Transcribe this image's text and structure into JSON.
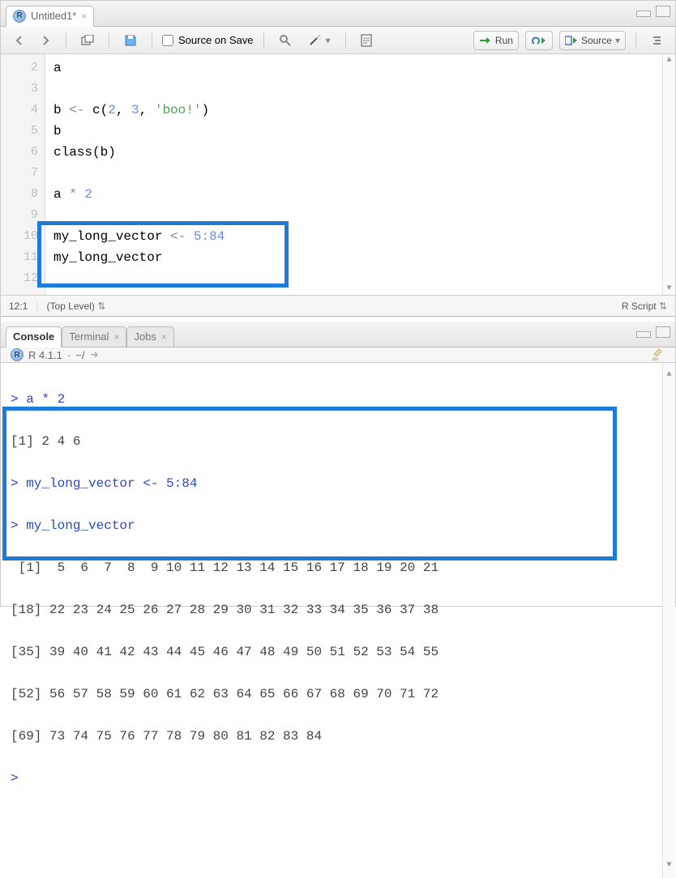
{
  "editor": {
    "tab": {
      "title": "Untitled1*",
      "icon": "r-icon"
    },
    "toolbar": {
      "source_on_save": "Source on Save",
      "run": "Run",
      "source": "Source"
    },
    "gutter": [
      "2",
      "3",
      "4",
      "5",
      "6",
      "7",
      "8",
      "9",
      "10",
      "11",
      "12"
    ],
    "lines": {
      "l2": "a",
      "l3": "",
      "l4_a": "b ",
      "l4_op": "<-",
      "l4_b": " c(",
      "l4_n1": "2",
      "l4_c": ", ",
      "l4_n2": "3",
      "l4_d": ", ",
      "l4_s": "'boo!'",
      "l4_e": ")",
      "l5": "b",
      "l6": "class(b)",
      "l7": "",
      "l8_a": "a ",
      "l8_op": "*",
      "l8_b": " ",
      "l8_n": "2",
      "l9": "",
      "l10_a": "my_long_vector ",
      "l10_op": "<-",
      "l10_b": " ",
      "l10_n1": "5",
      "l10_c": ":",
      "l10_n2": "84",
      "l11": "my_long_vector",
      "l12": ""
    },
    "status": {
      "pos": "12:1",
      "scope": "(Top Level)",
      "lang": "R Script"
    }
  },
  "console": {
    "tabs": {
      "console": "Console",
      "terminal": "Terminal",
      "jobs": "Jobs"
    },
    "header": {
      "version": "R 4.1.1",
      "sep": " · ",
      "wd": "~/"
    },
    "lines": {
      "in1": "> a * 2",
      "out1": "[1] 2 4 6",
      "in2": "> my_long_vector <- 5:84",
      "in3": "> my_long_vector",
      "out2": " [1]  5  6  7  8  9 10 11 12 13 14 15 16 17 18 19 20 21",
      "out3": "[18] 22 23 24 25 26 27 28 29 30 31 32 33 34 35 36 37 38",
      "out4": "[35] 39 40 41 42 43 44 45 46 47 48 49 50 51 52 53 54 55",
      "out5": "[52] 56 57 58 59 60 61 62 63 64 65 66 67 68 69 70 71 72",
      "out6": "[69] 73 74 75 76 77 78 79 80 81 82 83 84",
      "prompt": ">"
    }
  }
}
